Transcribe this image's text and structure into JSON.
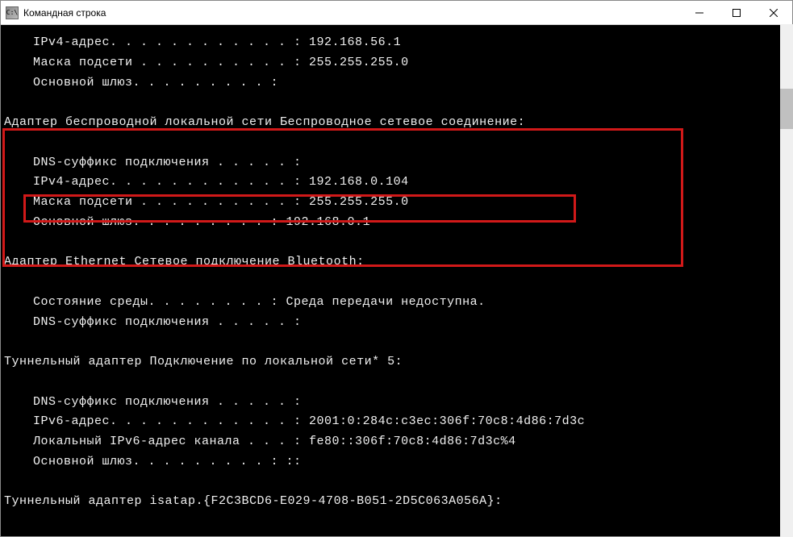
{
  "window": {
    "title": "Командная строка",
    "icon_text": "C:\\"
  },
  "terminal": {
    "lines": [
      {
        "cls": "indent",
        "text": "IPv4-адрес. . . . . . . . . . . . : 192.168.56.1"
      },
      {
        "cls": "indent",
        "text": "Маска подсети . . . . . . . . . . : 255.255.255.0"
      },
      {
        "cls": "indent",
        "text": "Основной шлюз. . . . . . . . . :"
      },
      {
        "cls": "blank",
        "text": ""
      },
      {
        "cls": "line",
        "text": "Адаптер беспроводной локальной сети Беспроводное сетевое соединение:"
      },
      {
        "cls": "blank",
        "text": ""
      },
      {
        "cls": "indent",
        "text": "DNS-суффикс подключения . . . . . :"
      },
      {
        "cls": "indent",
        "text": "IPv4-адрес. . . . . . . . . . . . : 192.168.0.104"
      },
      {
        "cls": "indent",
        "text": "Маска подсети . . . . . . . . . . : 255.255.255.0"
      },
      {
        "cls": "indent",
        "text": "Основной шлюз. . . . . . . . . : 192.168.0.1"
      },
      {
        "cls": "blank",
        "text": ""
      },
      {
        "cls": "line",
        "text": "Адаптер Ethernet Сетевое подключение Bluetooth:"
      },
      {
        "cls": "blank",
        "text": ""
      },
      {
        "cls": "indent",
        "text": "Состояние среды. . . . . . . . : Среда передачи недоступна."
      },
      {
        "cls": "indent",
        "text": "DNS-суффикс подключения . . . . . :"
      },
      {
        "cls": "blank",
        "text": ""
      },
      {
        "cls": "line",
        "text": "Туннельный адаптер Подключение по локальной сети* 5:"
      },
      {
        "cls": "blank",
        "text": ""
      },
      {
        "cls": "indent",
        "text": "DNS-суффикс подключения . . . . . :"
      },
      {
        "cls": "indent",
        "text": "IPv6-адрес. . . . . . . . . . . . : 2001:0:284c:c3ec:306f:70c8:4d86:7d3c"
      },
      {
        "cls": "indent",
        "text": "Локальный IPv6-адрес канала . . . : fe80::306f:70c8:4d86:7d3c%4"
      },
      {
        "cls": "indent",
        "text": "Основной шлюз. . . . . . . . . : ::"
      },
      {
        "cls": "blank",
        "text": ""
      },
      {
        "cls": "line",
        "text": "Туннельный адаптер isatap.{F2C3BCD6-E029-4708-B051-2D5C063A056A}:"
      }
    ]
  }
}
